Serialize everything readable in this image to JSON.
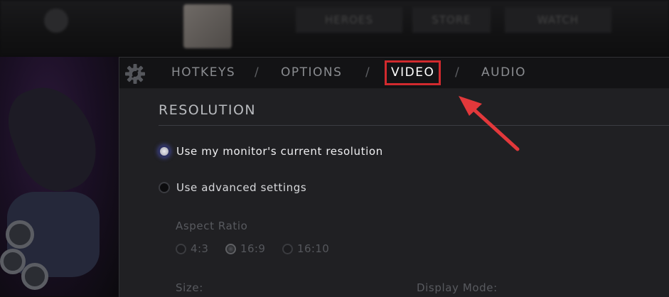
{
  "background_nav": {
    "tabs": [
      "HEROES",
      "STORE",
      "WATCH"
    ]
  },
  "tabs": [
    {
      "label": "HOTKEYS"
    },
    {
      "label": "OPTIONS"
    },
    {
      "label": "VIDEO"
    },
    {
      "label": "AUDIO"
    }
  ],
  "separator": "/",
  "active_tab": "VIDEO",
  "section": {
    "title": "RESOLUTION"
  },
  "resolution_options": [
    {
      "label": "Use my monitor's current resolution",
      "selected": true
    },
    {
      "label": "Use advanced settings",
      "selected": false
    }
  ],
  "aspect_ratio": {
    "label": "Aspect Ratio",
    "options": [
      {
        "label": "4:3",
        "selected": false
      },
      {
        "label": "16:9",
        "selected": true
      },
      {
        "label": "16:10",
        "selected": false
      }
    ]
  },
  "size_label": "Size:",
  "display_mode_label": "Display Mode:",
  "colors": {
    "highlight_box": "#d12a2e",
    "arrow": "#e2383b",
    "selected_glow": "#5a64d0"
  },
  "icons": {
    "settings": "gear-icon",
    "annotation": "red-arrow-annotation"
  }
}
